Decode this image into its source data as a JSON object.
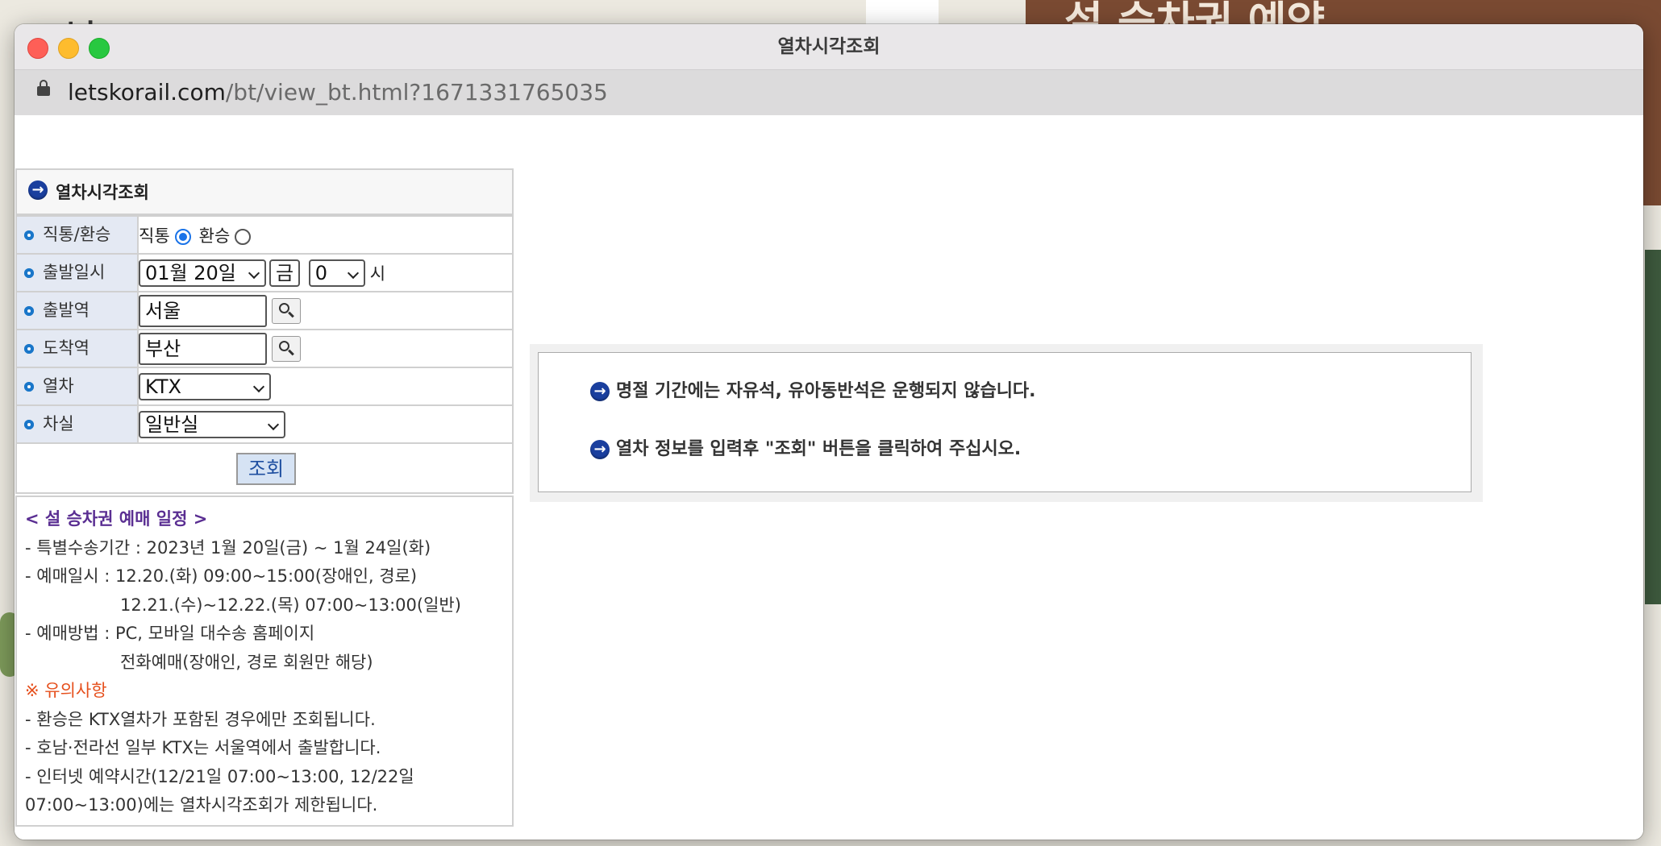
{
  "background": {
    "banner_text": "설 승차권 예약"
  },
  "window": {
    "title": "열차시각조회",
    "url_host": "letskorail.com",
    "url_path": "/bt/view_bt.html?1671331765035"
  },
  "form": {
    "heading": "열차시각조회",
    "rows": {
      "route_type": {
        "label": "직통/환승",
        "options": [
          "직통",
          "환승"
        ],
        "selected": "직통"
      },
      "departure": {
        "label": "출발일시",
        "date": "01월 20일",
        "weekday": "금",
        "hour": "0",
        "hour_unit": "시"
      },
      "from": {
        "label": "출발역",
        "value": "서울"
      },
      "to": {
        "label": "도착역",
        "value": "부산"
      },
      "train": {
        "label": "열차",
        "value": "KTX"
      },
      "car": {
        "label": "차실",
        "value": "일반실"
      }
    },
    "query_button": "조회"
  },
  "notice": {
    "title": "< 설 승차권 예매 일정 >",
    "lines": [
      "- 특별수송기간 : 2023년 1월 20일(금) ~ 1월 24일(화)",
      "- 예매일시 : 12.20.(화) 09:00~15:00(장애인, 경로)",
      "12.21.(수)~12.22.(목) 07:00~13:00(일반)",
      "- 예매방법 : PC, 모바일 대수송 홈페이지",
      "전화예매(장애인, 경로 회원만 해당)"
    ],
    "caution_title": "※ 유의사항",
    "caution_lines": [
      "- 환승은 KTX열차가 포함된 경우에만 조회됩니다.",
      "- 호남·전라선 일부 KTX는 서울역에서 출발합니다.",
      "- 인터넷 예약시간(12/21일 07:00~13:00, 12/22일",
      "07:00~13:00)에는 열차시각조회가 제한됩니다."
    ]
  },
  "info": {
    "line1": "명절 기간에는 자유석, 유아동반석은 운행되지 않습니다.",
    "line2": "열차 정보를 입력후 \"조회\" 버튼을 클릭하여 주십시오."
  }
}
